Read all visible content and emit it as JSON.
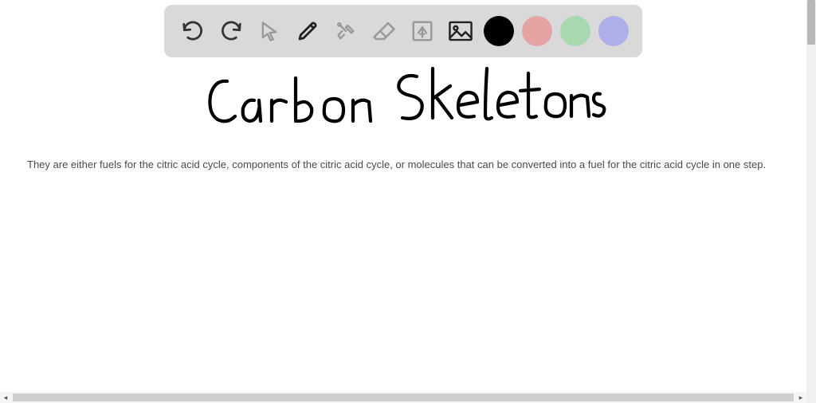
{
  "toolbar": {
    "undo": "undo",
    "redo": "redo",
    "pointer": "pointer",
    "pen": "pen",
    "tools": "tools",
    "eraser": "eraser",
    "text": "text",
    "image": "image",
    "colors": [
      {
        "name": "black",
        "hex": "#000000",
        "selected": true
      },
      {
        "name": "red",
        "hex": "#e6a3a3",
        "selected": false
      },
      {
        "name": "green",
        "hex": "#a8d8b0",
        "selected": false
      },
      {
        "name": "purple",
        "hex": "#aeaee8",
        "selected": false
      }
    ]
  },
  "canvas": {
    "title": "Carbon Skeletons",
    "body": "They are either fuels for the citric acid cycle, components of the citric acid cycle, or molecules that can be converted into a fuel for the citric acid cycle in one step."
  },
  "scroll": {
    "left_arrow": "◂",
    "right_arrow": "▸"
  }
}
